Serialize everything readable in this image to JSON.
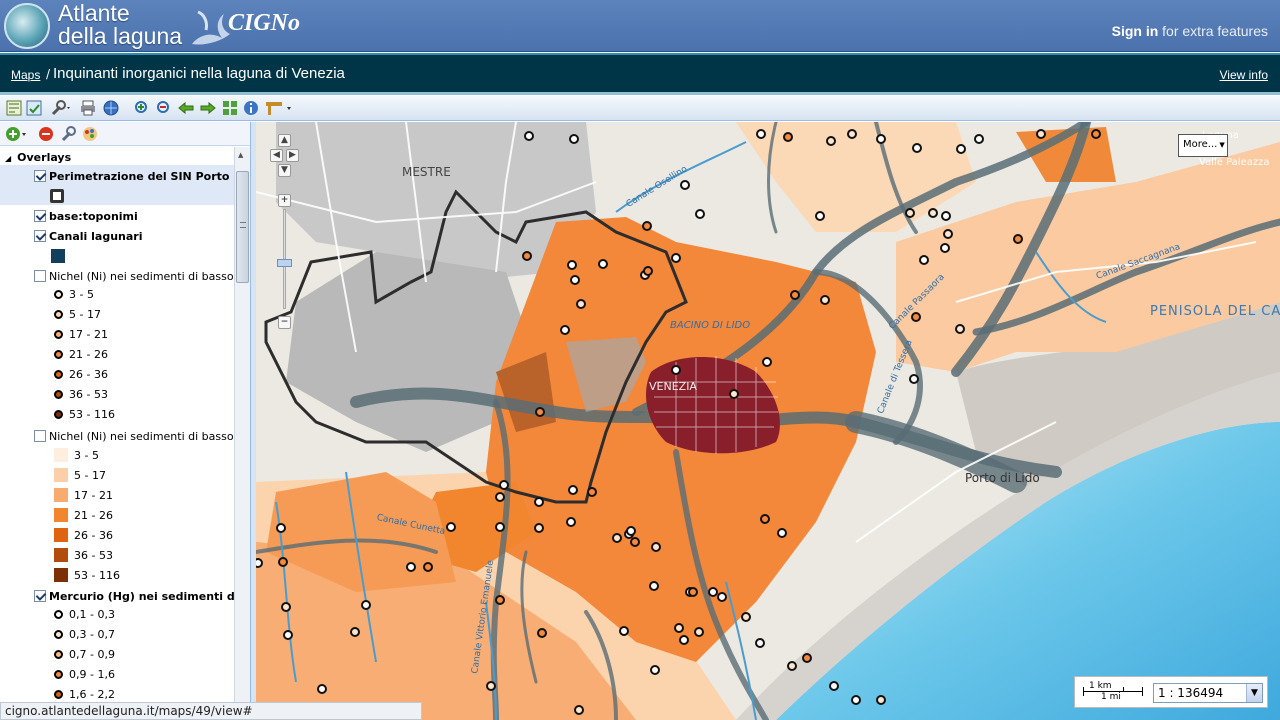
{
  "header": {
    "logo_line1": "Atlante",
    "logo_line2": "della laguna",
    "logo_brand": "CIGNo",
    "signin_link": "Sign in",
    "signin_suffix": " for extra features"
  },
  "titlebar": {
    "breadcrumb": "Maps",
    "separator": "/",
    "map_title": "Inquinanti inorganici nella laguna di Venezia",
    "view_info": "View info"
  },
  "toolbar": {
    "icons": [
      "new-map-icon",
      "save-map-icon",
      "tools-icon",
      "print-icon",
      "globe-icon",
      "zoom-in-icon",
      "zoom-out-icon",
      "back-arrow-icon",
      "forward-arrow-icon",
      "zoom-extent-icon",
      "info-icon",
      "measure-icon"
    ]
  },
  "sidebar": {
    "overlays_header": "Overlays",
    "layers": [
      {
        "label": "Perimetrazione del SIN Porto Margh",
        "checked": true,
        "bold": true
      },
      {
        "label": "base:toponimi",
        "checked": true,
        "bold": true
      },
      {
        "label": "Canali lagunari",
        "checked": true,
        "bold": true
      },
      {
        "label": "Nichel (Ni) nei sedimenti di basso fondale",
        "checked": false,
        "bold": false
      },
      {
        "label": "Nichel (Ni) nei sedimenti di basso fondale",
        "checked": false,
        "bold": false
      },
      {
        "label": "Mercurio (Hg) nei sedimenti di basso fondale",
        "checked": true,
        "bold": true
      }
    ],
    "nichel_points_legend": [
      {
        "label": "3 - 5",
        "color": "#fdf0e2"
      },
      {
        "label": "5 - 17",
        "color": "#fbd3ad"
      },
      {
        "label": "17 - 21",
        "color": "#f8ad74"
      },
      {
        "label": "21 - 26",
        "color": "#f3873a"
      },
      {
        "label": "26 - 36",
        "color": "#e26612"
      },
      {
        "label": "36 - 53",
        "color": "#b14d09"
      },
      {
        "label": "53 - 116",
        "color": "#7f2f05"
      }
    ],
    "nichel_areas_legend": [
      {
        "label": "3 - 5",
        "color": "#fdeee0"
      },
      {
        "label": "5 - 17",
        "color": "#fbd0a8"
      },
      {
        "label": "17 - 21",
        "color": "#f8ab6e"
      },
      {
        "label": "21 - 26",
        "color": "#f2862e"
      },
      {
        "label": "26 - 36",
        "color": "#df6410"
      },
      {
        "label": "36 - 53",
        "color": "#b14c0c"
      },
      {
        "label": "53 - 116",
        "color": "#7d3005"
      }
    ],
    "mercurio_legend": [
      {
        "label": "0,1 - 0,3",
        "color": "#ffffff"
      },
      {
        "label": "0,3 - 0,7",
        "color": "#fde5cf"
      },
      {
        "label": "0,7 - 0,9",
        "color": "#fbb986"
      },
      {
        "label": "0,9 - 1,6",
        "color": "#f58a3c"
      },
      {
        "label": "1,6 - 2,2",
        "color": "#d65f10"
      }
    ]
  },
  "map": {
    "more_button": "More...",
    "labels": {
      "mestre": "MESTRE",
      "venezia": "VENEZIA",
      "bacino": "BACINO DI LIDO",
      "porto_lido": "Porto di Lido",
      "penisola": "PENISOLA DEL CAV",
      "valle_paleazza": "Valle Paleazza",
      "canale_osellino": "Canale Osellino",
      "canale_saccagnana": "Canale Saccagnana",
      "canale_cunetta": "Canale Cunetta",
      "canale_tessera": "Canale di Tessera",
      "canale_passaora": "Canale Passaora",
      "canale_vittorio": "Canale Vittorio Emanuele",
      "laguna": "Laguna"
    },
    "scale_km": "1 km",
    "scale_mi": "1 mi",
    "scale_value": "1 : 136494"
  },
  "status_url": "cigno.atlantedellaguna.it/maps/49/view#"
}
